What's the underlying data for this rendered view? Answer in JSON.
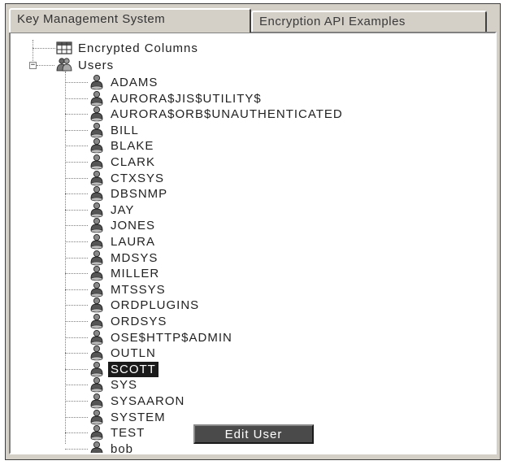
{
  "tabs": [
    {
      "label": "Key Management System"
    },
    {
      "label": "Encryption API Examples"
    }
  ],
  "tree": {
    "encrypted_columns": {
      "label": "Encrypted Columns",
      "icon": "table-grid-icon"
    },
    "users_node": {
      "label": "Users",
      "icon": "users-group-icon",
      "expanded": true
    },
    "users": [
      {
        "label": "ADAMS"
      },
      {
        "label": "AURORA$JIS$UTILITY$"
      },
      {
        "label": "AURORA$ORB$UNAUTHENTICATED"
      },
      {
        "label": "BILL"
      },
      {
        "label": "BLAKE"
      },
      {
        "label": "CLARK"
      },
      {
        "label": "CTXSYS"
      },
      {
        "label": "DBSNMP"
      },
      {
        "label": "JAY"
      },
      {
        "label": "JONES"
      },
      {
        "label": "LAURA"
      },
      {
        "label": "MDSYS"
      },
      {
        "label": "MILLER"
      },
      {
        "label": "MTSSYS"
      },
      {
        "label": "ORDPLUGINS"
      },
      {
        "label": "ORDSYS"
      },
      {
        "label": "OSE$HTTP$ADMIN"
      },
      {
        "label": "OUTLN"
      },
      {
        "label": "SCOTT",
        "selected": true
      },
      {
        "label": "SYS"
      },
      {
        "label": "SYSAARON"
      },
      {
        "label": "SYSTEM"
      },
      {
        "label": "TEST"
      },
      {
        "label": "bob"
      }
    ]
  },
  "context_menu": {
    "item": "Edit User"
  },
  "colors": {
    "selection": "#1a1a1a",
    "menu_bg": "#4a4a4a",
    "window_bg": "#d4d0c8"
  }
}
